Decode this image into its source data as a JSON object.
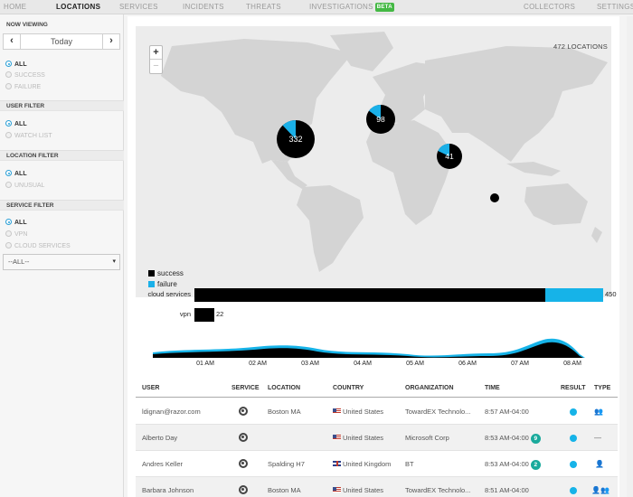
{
  "nav": {
    "items": [
      {
        "label": "HOME",
        "active": false
      },
      {
        "label": "LOCATIONS",
        "active": true
      },
      {
        "label": "SERVICES",
        "active": false
      },
      {
        "label": "INCIDENTS",
        "active": false
      },
      {
        "label": "THREATS",
        "active": false
      },
      {
        "label": "INVESTIGATIONS",
        "active": false,
        "badge": "BETA"
      },
      {
        "label": "COLLECTORS",
        "active": false
      },
      {
        "label": "SETTINGS",
        "active": false
      }
    ]
  },
  "sidebar": {
    "now_viewing": {
      "title": "NOW VIEWING",
      "prev_glyph": "‹",
      "date_label": "Today",
      "next_glyph": "›",
      "options": [
        {
          "label": "ALL",
          "selected": true
        },
        {
          "label": "SUCCESS",
          "selected": false
        },
        {
          "label": "FAILURE",
          "selected": false
        }
      ]
    },
    "user_filter": {
      "title": "USER FILTER",
      "options": [
        {
          "label": "ALL",
          "selected": true
        },
        {
          "label": "WATCH LIST",
          "selected": false
        }
      ]
    },
    "location_filter": {
      "title": "LOCATION FILTER",
      "options": [
        {
          "label": "ALL",
          "selected": true
        },
        {
          "label": "UNUSUAL",
          "selected": false
        }
      ]
    },
    "service_filter": {
      "title": "SERVICE FILTER",
      "options": [
        {
          "label": "ALL",
          "selected": true
        },
        {
          "label": "VPN",
          "selected": false
        },
        {
          "label": "CLOUD SERVICES",
          "selected": false
        }
      ],
      "select_value": "--ALL--",
      "select_caret": "▾"
    }
  },
  "map": {
    "location_count": "472 LOCATIONS",
    "zoom_in": "+",
    "zoom_out": "−",
    "legend": [
      {
        "label": "success",
        "color": "#000000"
      },
      {
        "label": "failure",
        "color": "#1ab0e8"
      }
    ],
    "clusters": [
      {
        "region": "north-america",
        "count": "332",
        "failure_fraction": 0.12
      },
      {
        "region": "europe",
        "count": "98",
        "failure_fraction": 0.15
      },
      {
        "region": "southeast-asia",
        "count": "41",
        "failure_fraction": 0.18
      },
      {
        "region": "australia",
        "count": "",
        "failure_fraction": 0.0
      }
    ]
  },
  "services": [
    {
      "name": "cloud services",
      "total": "450",
      "success": 386,
      "failure": 64
    },
    {
      "name": "vpn",
      "total": "22",
      "success": 22,
      "failure": 0
    }
  ],
  "timeline": {
    "ticks": [
      "01 AM",
      "02 AM",
      "03 AM",
      "04 AM",
      "05 AM",
      "06 AM",
      "07 AM",
      "08 AM"
    ]
  },
  "table": {
    "columns": [
      "USER",
      "SERVICE",
      "LOCATION",
      "COUNTRY",
      "ORGANIZATION",
      "TIME",
      "RESULT",
      "TYPE"
    ],
    "rows": [
      {
        "user": "ldignan@razor.com",
        "location": "Boston MA",
        "country": "United States",
        "flag": "us",
        "organization": "TowardEX Technolo...",
        "time": "8:57 AM-04:00",
        "badge": "",
        "type_glyph": "👥"
      },
      {
        "user": "Alberto Day",
        "location": "",
        "country": "United States",
        "flag": "us",
        "organization": "Microsoft Corp",
        "time": "8:53 AM-04:00",
        "badge": "9",
        "type_glyph": "—"
      },
      {
        "user": "Andres Keller",
        "location": "Spalding H7",
        "country": "United Kingdom",
        "flag": "uk",
        "organization": "BT",
        "time": "8:53 AM-04:00",
        "badge": "2",
        "type_glyph": "👤"
      },
      {
        "user": "Barbara Johnson",
        "location": "Boston MA",
        "country": "United States",
        "flag": "us",
        "organization": "TowardEX Technolo...",
        "time": "8:51 AM-04:00",
        "badge": "",
        "type_glyph": "👤👥"
      }
    ]
  }
}
